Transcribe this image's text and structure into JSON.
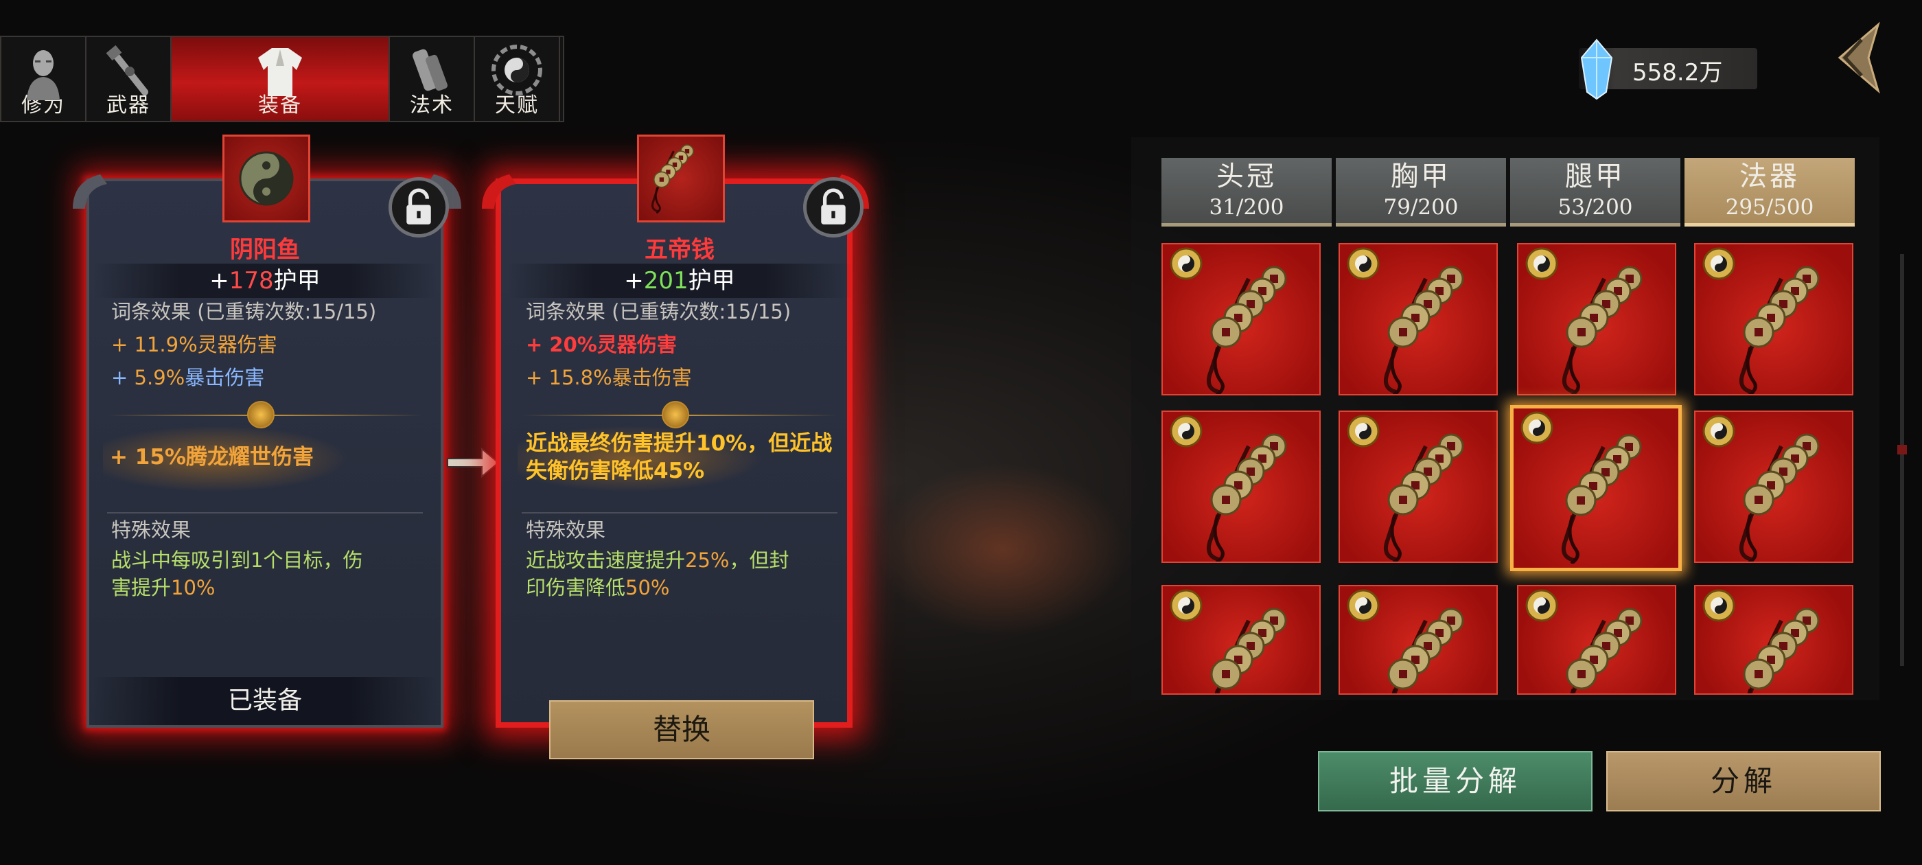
{
  "tabs": [
    {
      "label": "修为",
      "icon": "character-icon",
      "active": false
    },
    {
      "label": "武器",
      "icon": "weapon-icon",
      "active": false
    },
    {
      "label": "装备",
      "icon": "armor-robe-icon",
      "active": true
    },
    {
      "label": "法术",
      "icon": "spell-scroll-icon",
      "active": false
    },
    {
      "label": "天赋",
      "icon": "taiji-bagua-icon",
      "active": false
    }
  ],
  "currency": {
    "value": "558.2万",
    "icon": "spirit-crystal-icon"
  },
  "left_card": {
    "name": "阴阳鱼",
    "armor_prefix": "+",
    "armor_value": "178",
    "armor_label": "护甲",
    "affix_header": "词条效果 (已重铸次数:15/15)",
    "affix1_sign": "+ ",
    "affix1_value": "11.9%",
    "affix1_name": "灵器伤害",
    "affix2_sign": "+ ",
    "affix2_value": "5.9%",
    "affix2_name": "暴击伤害",
    "bonus_text": "+ 15%腾龙耀世伤害",
    "special_header": "特殊效果",
    "special_a": "战斗中每吸引到1个目标，伤",
    "special_b": "害提升",
    "special_b_value": "10%",
    "status": "已装备"
  },
  "right_card": {
    "name": "五帝钱",
    "armor_prefix": "+",
    "armor_value": "201",
    "armor_label": "护甲",
    "affix_header": "词条效果 (已重铸次数:15/15)",
    "affix1_sign": "+ ",
    "affix1_value": "20%",
    "affix1_name": "灵器伤害",
    "affix2_sign": "+ ",
    "affix2_value": "15.8%",
    "affix2_name": "暴击伤害",
    "bonus_line1": "近战最终伤害提升10%，但近战",
    "bonus_line2": "失衡伤害降低45%",
    "special_header": "特殊效果",
    "special_a": "近战攻击速度提升",
    "special_a_value": "25%",
    "special_a_tail": "，但封",
    "special_b": "印伤害降低",
    "special_b_value": "50%",
    "swap_button": "替换"
  },
  "categories": [
    {
      "name": "头冠",
      "count": "31/200",
      "active": false
    },
    {
      "name": "胸甲",
      "count": "79/200",
      "active": false
    },
    {
      "name": "腿甲",
      "count": "53/200",
      "active": false
    },
    {
      "name": "法器",
      "count": "295/500",
      "active": true
    }
  ],
  "inventory": {
    "item_icon": "five-emperor-coins-icon",
    "badge_icon": "taiji-badge-icon",
    "selected_index": 6,
    "slot_count": 12
  },
  "buttons": {
    "batch_decompose": "批量分解",
    "decompose": "分解"
  },
  "colors": {
    "accent_red": "#e11d1d",
    "tab_active": "#c21818",
    "button_green": "#4c8c69",
    "button_tan": "#b8986a",
    "highlight_yellow": "#ffc329"
  }
}
